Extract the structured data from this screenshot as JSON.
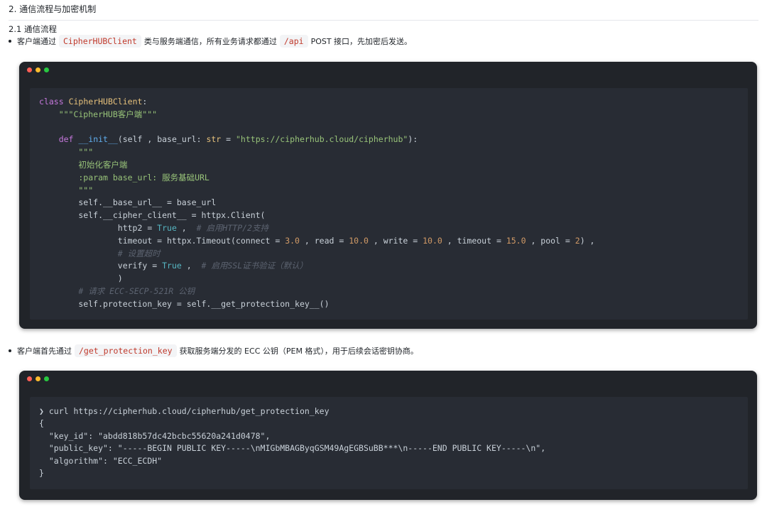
{
  "heading": "2. 通信流程与加密机制",
  "subheading": "2.1 通信流程",
  "bullets": [
    {
      "pre": "客户端通过",
      "code": "CipherHUBClient",
      "mid": "类与服务端通信，所有业务请求都通过",
      "code2": "/api",
      "post": "POST 接口，先加密后发送。"
    },
    {
      "pre": "客户端首先通过",
      "code": "/get_protection_key",
      "post": "获取服务端分发的 ECC 公钥（PEM 格式），用于后续会话密钥协商。"
    }
  ],
  "colors": {
    "red": "#ff5f57",
    "yellow": "#febc2e",
    "green": "#28c840"
  },
  "code1": {
    "l1_kw": "class",
    "l1_name": "CipherHUBClient",
    "l1_tail": ":",
    "l2": "    \"\"\"CipherHUB客户端\"\"\"",
    "l4_kw": "def",
    "l4_fn": "__init__",
    "l4_a": "(self , base_url: ",
    "l4_type": "str",
    "l4_b": " = ",
    "l4_str": "\"https://cipherhub.cloud/cipherhub\"",
    "l4_c": "):",
    "l5": "        \"\"\"",
    "l6": "        初始化客户端",
    "l7": "        :param base_url: 服务基础URL",
    "l8": "        \"\"\"",
    "l9": "        self.__base_url__ = base_url",
    "l10": "        self.__cipher_client__ = httpx.Client(",
    "l11_a": "                http2 = ",
    "l11_b": "True",
    "l11_c": " ,  ",
    "l11_cmt": "# 启用HTTP/2支持",
    "l12_a": "                timeout = httpx.Timeout(connect = ",
    "l12_n1": "3.0",
    "l12_b": " , read = ",
    "l12_n2": "10.0",
    "l12_c": " , write = ",
    "l12_n3": "10.0",
    "l12_d": " , timeout = ",
    "l12_n4": "15.0",
    "l12_e": " , pool = ",
    "l12_n5": "2",
    "l12_f": ") ,",
    "l13": "                # 设置超时",
    "l14_a": "                verify = ",
    "l14_b": "True",
    "l14_c": " ,  ",
    "l14_cmt": "# 启用SSL证书验证（默认）",
    "l15": "                )",
    "l16": "        # 请求 ECC-SECP-521R 公钥",
    "l17": "        self.protection_key = self.__get_protection_key__()"
  },
  "code2": {
    "l1_prompt": "❯",
    "l1": " curl https://cipherhub.cloud/cipherhub/get_protection_key",
    "l2": "{",
    "l3": "  \"key_id\": \"abdd818b57dc42bcbc55620a241d0478\",",
    "l4": "  \"public_key\": \"-----BEGIN PUBLIC KEY-----\\nMIGbMBAGByqGSM49AgEGBSuBB***\\n-----END PUBLIC KEY-----\\n\",",
    "l5": "  \"algorithm\": \"ECC_ECDH\"",
    "l6": "}"
  }
}
